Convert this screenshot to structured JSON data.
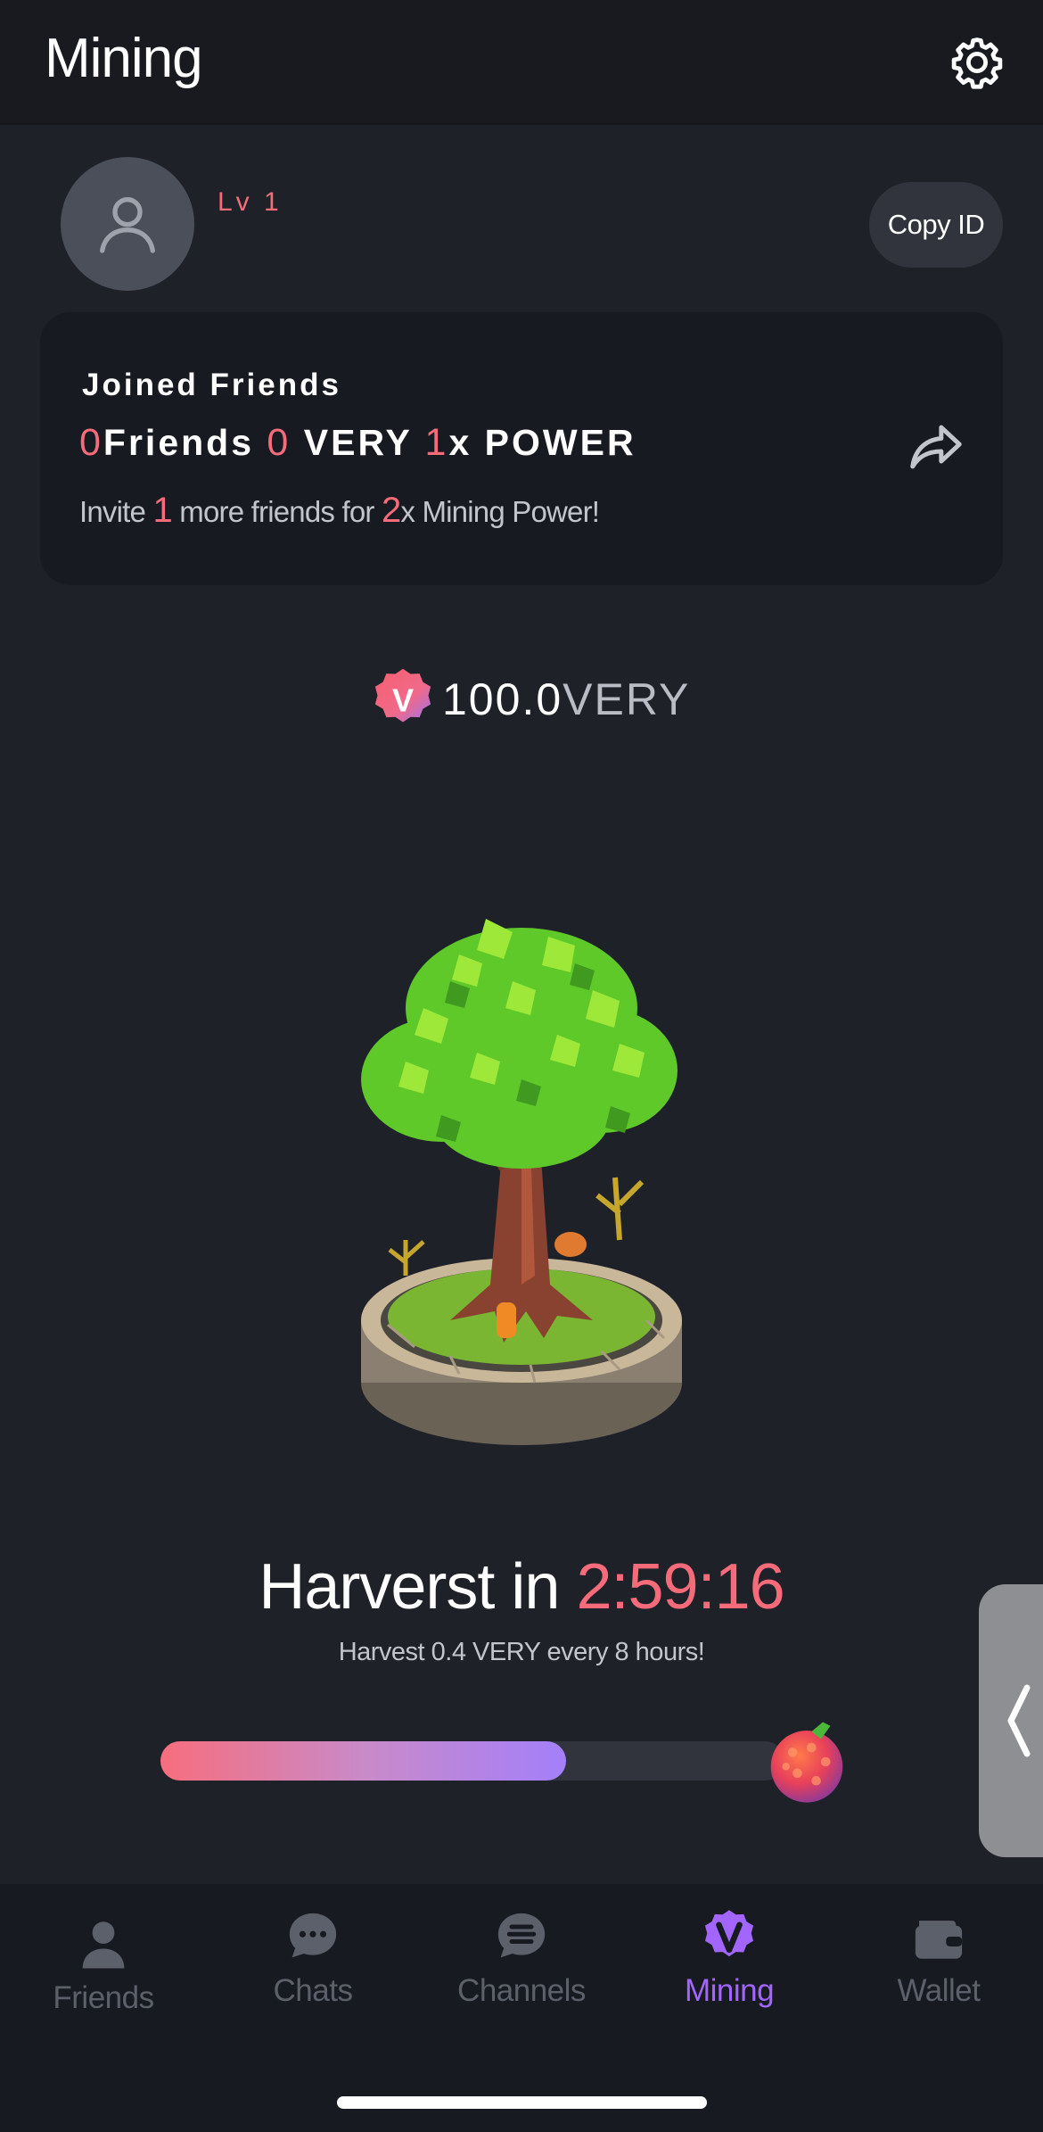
{
  "header": {
    "title": "Mining",
    "settings_icon": "gear-icon"
  },
  "profile": {
    "level": "Lv 1",
    "copy_label": "Copy ID"
  },
  "friends_card": {
    "title": "Joined Friends",
    "friends_count": "0",
    "friends_label": "Friends",
    "very_count": "0",
    "very_label": "VERY",
    "power_mult": "1",
    "power_label": "x POWER",
    "invite_prefix": "Invite",
    "invite_count": "1",
    "invite_mid": "more friends for",
    "invite_mult": "2",
    "invite_suffix": "x Mining Power!"
  },
  "balance": {
    "badge_letter": "V",
    "amount": "100.0",
    "unit": "VERY"
  },
  "harvest": {
    "title_prefix": "Harverst in",
    "timer": "2:59:16",
    "subtitle": "Harvest 0.4 VERY every 8 hours!",
    "progress": 0.65
  },
  "tabs": [
    {
      "label": "Friends",
      "icon": "person-icon",
      "active": false
    },
    {
      "label": "Chats",
      "icon": "chat-icon",
      "active": false
    },
    {
      "label": "Channels",
      "icon": "channels-icon",
      "active": false
    },
    {
      "label": "Mining",
      "icon": "very-v-icon",
      "active": true
    },
    {
      "label": "Wallet",
      "icon": "wallet-icon",
      "active": false
    }
  ],
  "colors": {
    "accent_red": "#f56b7a",
    "accent_purple": "#a266ff",
    "background": "#1f2129"
  }
}
